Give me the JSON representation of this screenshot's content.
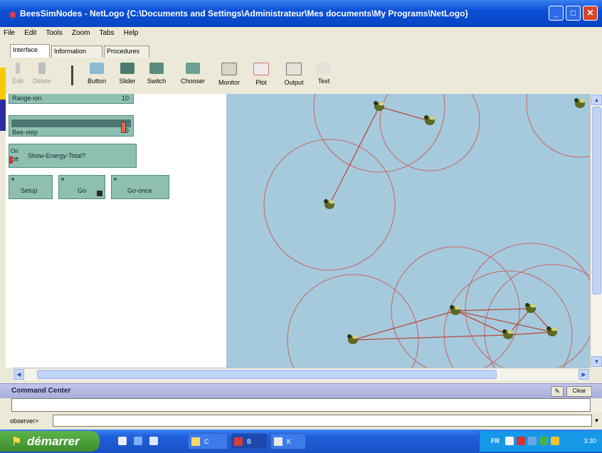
{
  "window": {
    "title": "BeesSimNodes - NetLogo {C:\\Documents and Settings\\Administrateur\\Mes documents\\My Programs\\NetLogo}",
    "controls": {
      "minimize": "_",
      "maximize": "□",
      "close": "✕"
    }
  },
  "menu": [
    "File",
    "Edit",
    "Tools",
    "Zoom",
    "Tabs",
    "Help"
  ],
  "tabs": [
    "Interface",
    "Information",
    "Procedures"
  ],
  "toolbar": {
    "edit": "Edit",
    "delete": "Delete",
    "button": "Button",
    "slider": "Slider",
    "switch": "Switch",
    "chooser": "Chooser",
    "monitor": "Monitor",
    "plot": "Plot",
    "output": "Output",
    "text": "Text"
  },
  "widgets": {
    "slider1": {
      "label": "Range-ion",
      "value": "10"
    },
    "slider2": {
      "label": "Bee-step",
      "value": "9",
      "fraction": 0.94
    },
    "switch": {
      "on": "On",
      "off": "Off",
      "label": "Show-Energy-Total?"
    },
    "buttons": [
      "Setup",
      "Go",
      "Go-once"
    ]
  },
  "command_center": {
    "title": "Command Center",
    "clear": "Clear",
    "agent": "observer>",
    "input": ""
  },
  "taskbar": {
    "start": "démarrer",
    "buttons": [
      "C",
      "B",
      "K"
    ],
    "lang": "FR",
    "clock": "3:30"
  },
  "colors": {
    "world_bg": "#a5cadd",
    "radius_circle": "#c86b6b",
    "link": "#b84a3a",
    "widget": "#8fbfb1"
  }
}
